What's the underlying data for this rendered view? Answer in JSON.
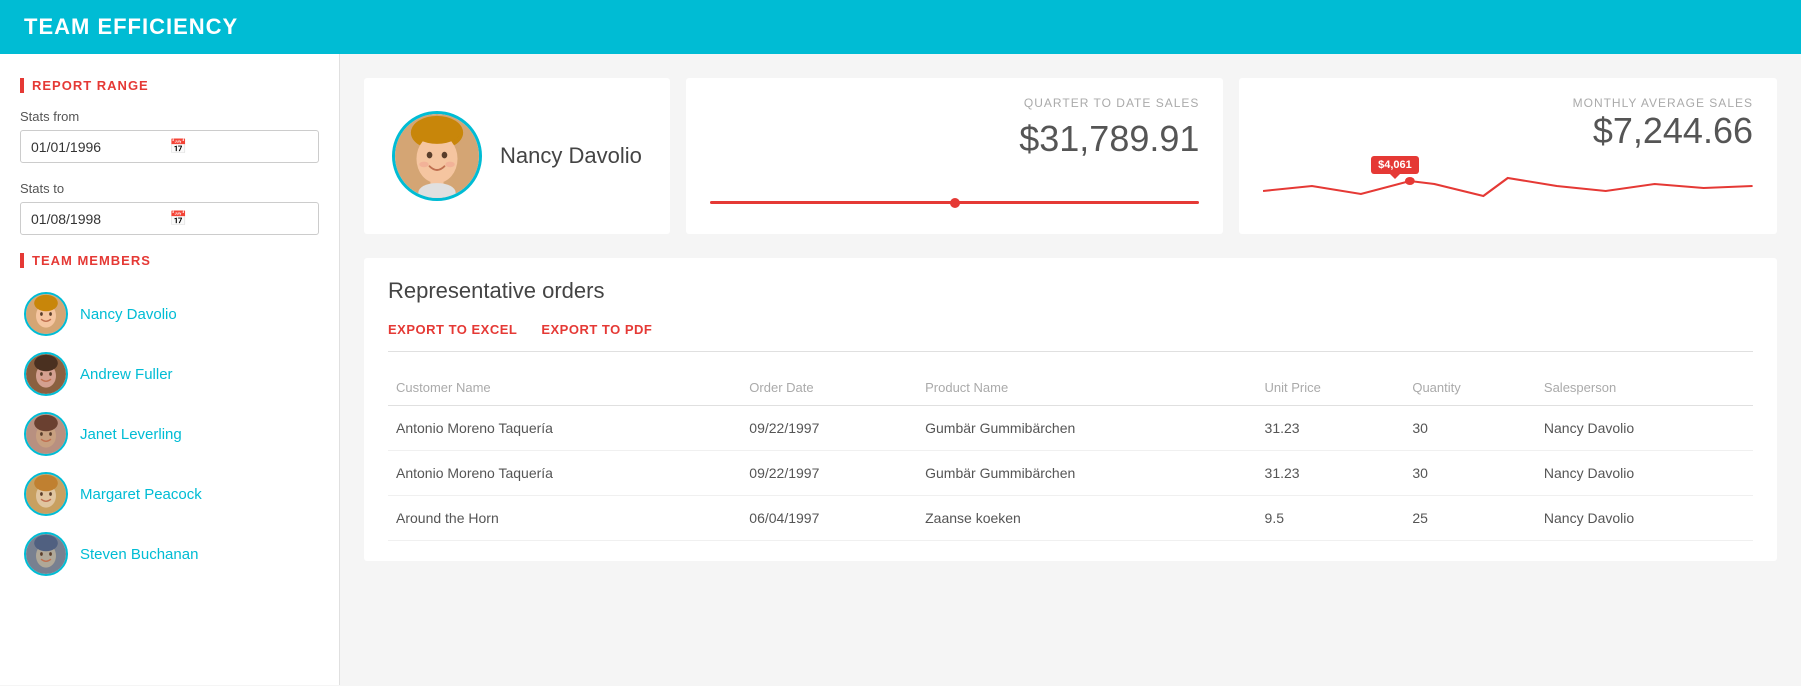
{
  "header": {
    "title": "TEAM EFFICIENCY"
  },
  "sidebar": {
    "report_range_label": "REPORT RANGE",
    "stats_from_label": "Stats from",
    "stats_from_value": "01/01/1996",
    "stats_to_label": "Stats to",
    "stats_to_value": "01/08/1998",
    "team_members_label": "TEAM MEMBERS",
    "members": [
      {
        "name": "Nancy Davolio",
        "id": "nancy"
      },
      {
        "name": "Andrew Fuller",
        "id": "andrew"
      },
      {
        "name": "Janet Leverling",
        "id": "janet"
      },
      {
        "name": "Margaret Peacock",
        "id": "margaret"
      },
      {
        "name": "Steven Buchanan",
        "id": "steven"
      }
    ]
  },
  "profile": {
    "name": "Nancy Davolio"
  },
  "quarter_sales": {
    "label": "QUARTER TO DATE SALES",
    "value": "$31,789.91"
  },
  "monthly_sales": {
    "label": "MONTHLY AVERAGE SALES",
    "value": "$7,244.66",
    "tooltip": "$4,061"
  },
  "orders": {
    "title": "Representative orders",
    "export_excel": "EXPORT TO EXCEL",
    "export_pdf": "EXPORT TO PDF",
    "columns": [
      "Customer Name",
      "Order Date",
      "Product Name",
      "Unit Price",
      "Quantity",
      "Salesperson"
    ],
    "rows": [
      {
        "customer": "Antonio Moreno Taquería",
        "order_date": "09/22/1997",
        "product": "Gumbär Gummibärchen",
        "unit_price": "31.23",
        "quantity": "30",
        "salesperson": "Nancy Davolio"
      },
      {
        "customer": "Antonio Moreno Taquería",
        "order_date": "09/22/1997",
        "product": "Gumbär Gummibärchen",
        "unit_price": "31.23",
        "quantity": "30",
        "salesperson": "Nancy Davolio"
      },
      {
        "customer": "Around the Horn",
        "order_date": "06/04/1997",
        "product": "Zaanse koeken",
        "unit_price": "9.5",
        "quantity": "25",
        "salesperson": "Nancy Davolio"
      }
    ]
  }
}
